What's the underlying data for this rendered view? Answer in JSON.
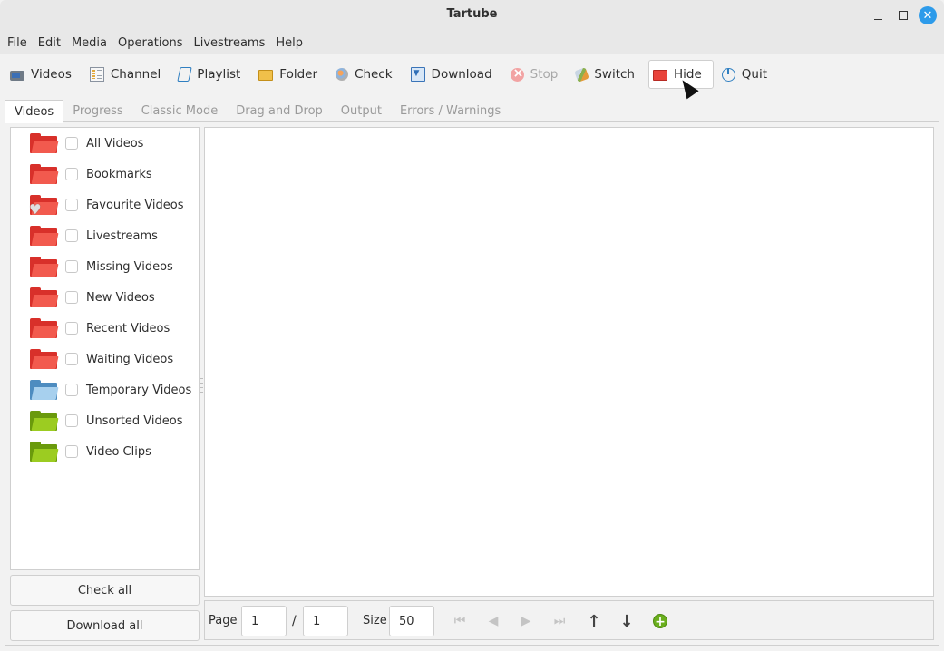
{
  "window": {
    "title": "Tartube",
    "controls": {
      "minimize": "–",
      "maximize": "□",
      "close": "✕"
    }
  },
  "menubar": [
    "File",
    "Edit",
    "Media",
    "Operations",
    "Livestreams",
    "Help"
  ],
  "toolbar": [
    {
      "label": "Videos",
      "icon": "video-camera-icon",
      "state": "normal"
    },
    {
      "label": "Channel",
      "icon": "channel-icon",
      "state": "normal"
    },
    {
      "label": "Playlist",
      "icon": "playlist-scroll-icon",
      "state": "normal"
    },
    {
      "label": "Folder",
      "icon": "folder-icon",
      "state": "normal"
    },
    {
      "label": "Check",
      "icon": "check-magnifier-icon",
      "state": "normal"
    },
    {
      "label": "Download",
      "icon": "download-icon",
      "state": "normal"
    },
    {
      "label": "Stop",
      "icon": "stop-icon",
      "state": "disabled"
    },
    {
      "label": "Switch",
      "icon": "switch-icon",
      "state": "normal"
    },
    {
      "label": "Hide",
      "icon": "red-folder-icon",
      "state": "hover"
    },
    {
      "label": "Quit",
      "icon": "power-icon",
      "state": "normal"
    }
  ],
  "tabs": [
    {
      "label": "Videos",
      "active": true
    },
    {
      "label": "Progress",
      "active": false
    },
    {
      "label": "Classic Mode",
      "active": false
    },
    {
      "label": "Drag and Drop",
      "active": false
    },
    {
      "label": "Output",
      "active": false
    },
    {
      "label": "Errors / Warnings",
      "active": false
    }
  ],
  "folders": [
    {
      "label": "All Videos",
      "color": "red",
      "checked": false
    },
    {
      "label": "Bookmarks",
      "color": "red",
      "checked": false
    },
    {
      "label": "Favourite Videos",
      "color": "red",
      "checked": false,
      "badge": "heart"
    },
    {
      "label": "Livestreams",
      "color": "red",
      "checked": false
    },
    {
      "label": "Missing Videos",
      "color": "red",
      "checked": false
    },
    {
      "label": "New Videos",
      "color": "red",
      "checked": false
    },
    {
      "label": "Recent Videos",
      "color": "red",
      "checked": false
    },
    {
      "label": "Waiting Videos",
      "color": "red",
      "checked": false
    },
    {
      "label": "Temporary Videos",
      "color": "blue",
      "checked": false
    },
    {
      "label": "Unsorted Videos",
      "color": "green",
      "checked": false
    },
    {
      "label": "Video Clips",
      "color": "green",
      "checked": false
    }
  ],
  "buttons": {
    "check_all": "Check all",
    "download_all": "Download all"
  },
  "pager": {
    "page_label": "Page",
    "page_value": "1",
    "separator": "/",
    "total_pages": "1",
    "size_label": "Size",
    "size_value": "50"
  },
  "colors": {
    "folder_red": "#f25a4e",
    "folder_blue": "#a7d0ee",
    "folder_green": "#9ccc21",
    "close_button": "#2d9bea",
    "add_button": "#6aae1d"
  }
}
